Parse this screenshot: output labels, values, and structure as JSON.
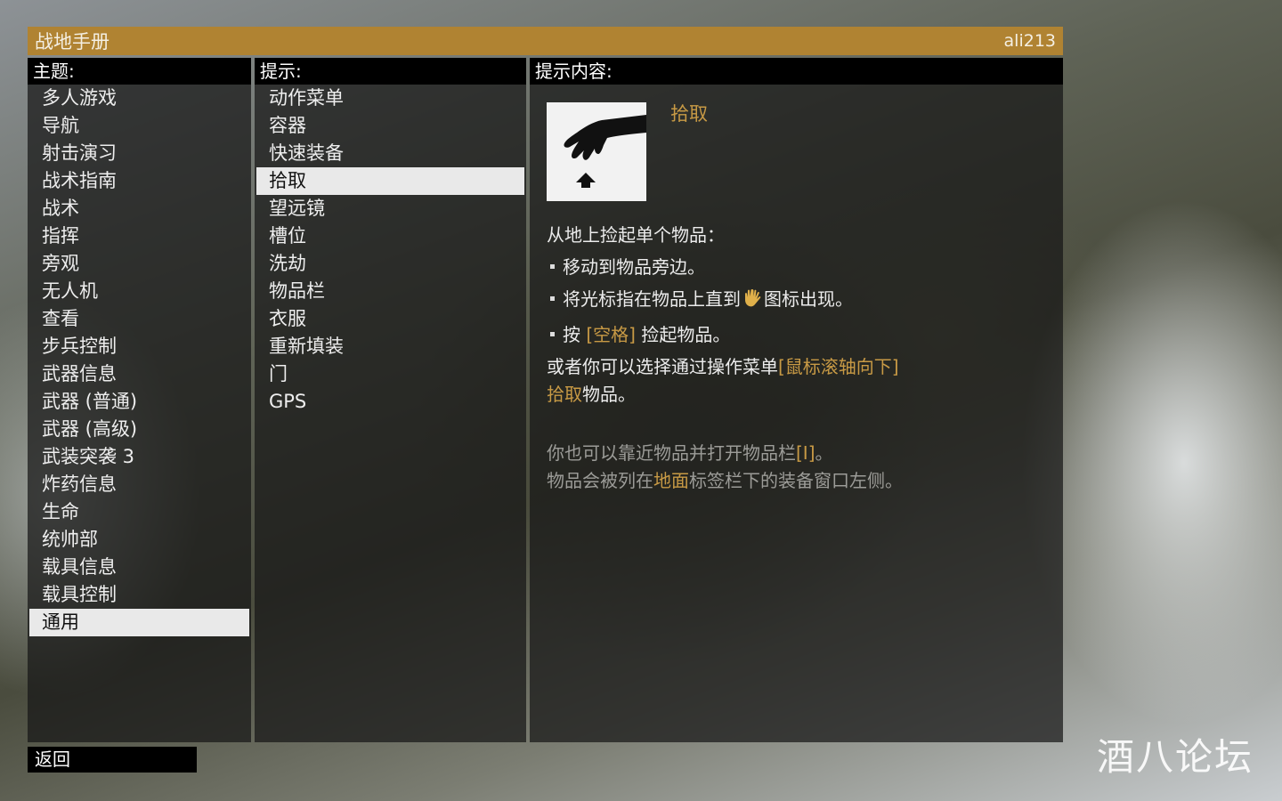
{
  "window": {
    "title": "战地手册",
    "site_tag": "ali213"
  },
  "topics": {
    "header": "主题:",
    "items": [
      "多人游戏",
      "导航",
      "射击演习",
      "战术指南",
      "战术",
      "指挥",
      "旁观",
      "无人机",
      "查看",
      "步兵控制",
      "武器信息",
      "武器 (普通)",
      "武器 (高级)",
      "武装突袭 3",
      "炸药信息",
      "生命",
      "统帅部",
      "载具信息",
      "载具控制",
      "通用"
    ],
    "selected": "通用"
  },
  "hints": {
    "header": "提示:",
    "items": [
      "动作菜单",
      "容器",
      "快速装备",
      "拾取",
      "望远镜",
      "槽位",
      "洗劫",
      "物品栏",
      "衣服",
      "重新填装",
      "门",
      "GPS"
    ],
    "selected": "拾取"
  },
  "content": {
    "header": "提示内容:",
    "icon": "pickup-hand-icon",
    "title": "拾取",
    "line1": "从地上捡起单个物品：",
    "bullet1": "移动到物品旁边。",
    "bullet2_a": "将光标指在物品上直到",
    "bullet2_icon": "hand-cursor-icon",
    "bullet2_b": "图标出现。",
    "bullet3_a": "按 ",
    "bullet3_key": "[空格]",
    "bullet3_b": " 捡起物品。",
    "line5_a": "或者你可以选择通过操作菜单",
    "line5_key": "[鼠标滚轴向下]",
    "line6_key": "拾取",
    "line6_b": "物品。",
    "dim1_a": "你也可以靠近物品并打开物品栏",
    "dim1_key": "[I]",
    "dim1_b": "。",
    "dim2_a": "物品会被列在",
    "dim2_key": "地面",
    "dim2_b": "标签栏下的装备窗口左侧。"
  },
  "footer": {
    "back_label": "返回",
    "watermark": "酒八论坛"
  },
  "colors": {
    "title_bar": "#b08332",
    "highlight": "#c89a45",
    "selection": "#e9e9e9"
  }
}
